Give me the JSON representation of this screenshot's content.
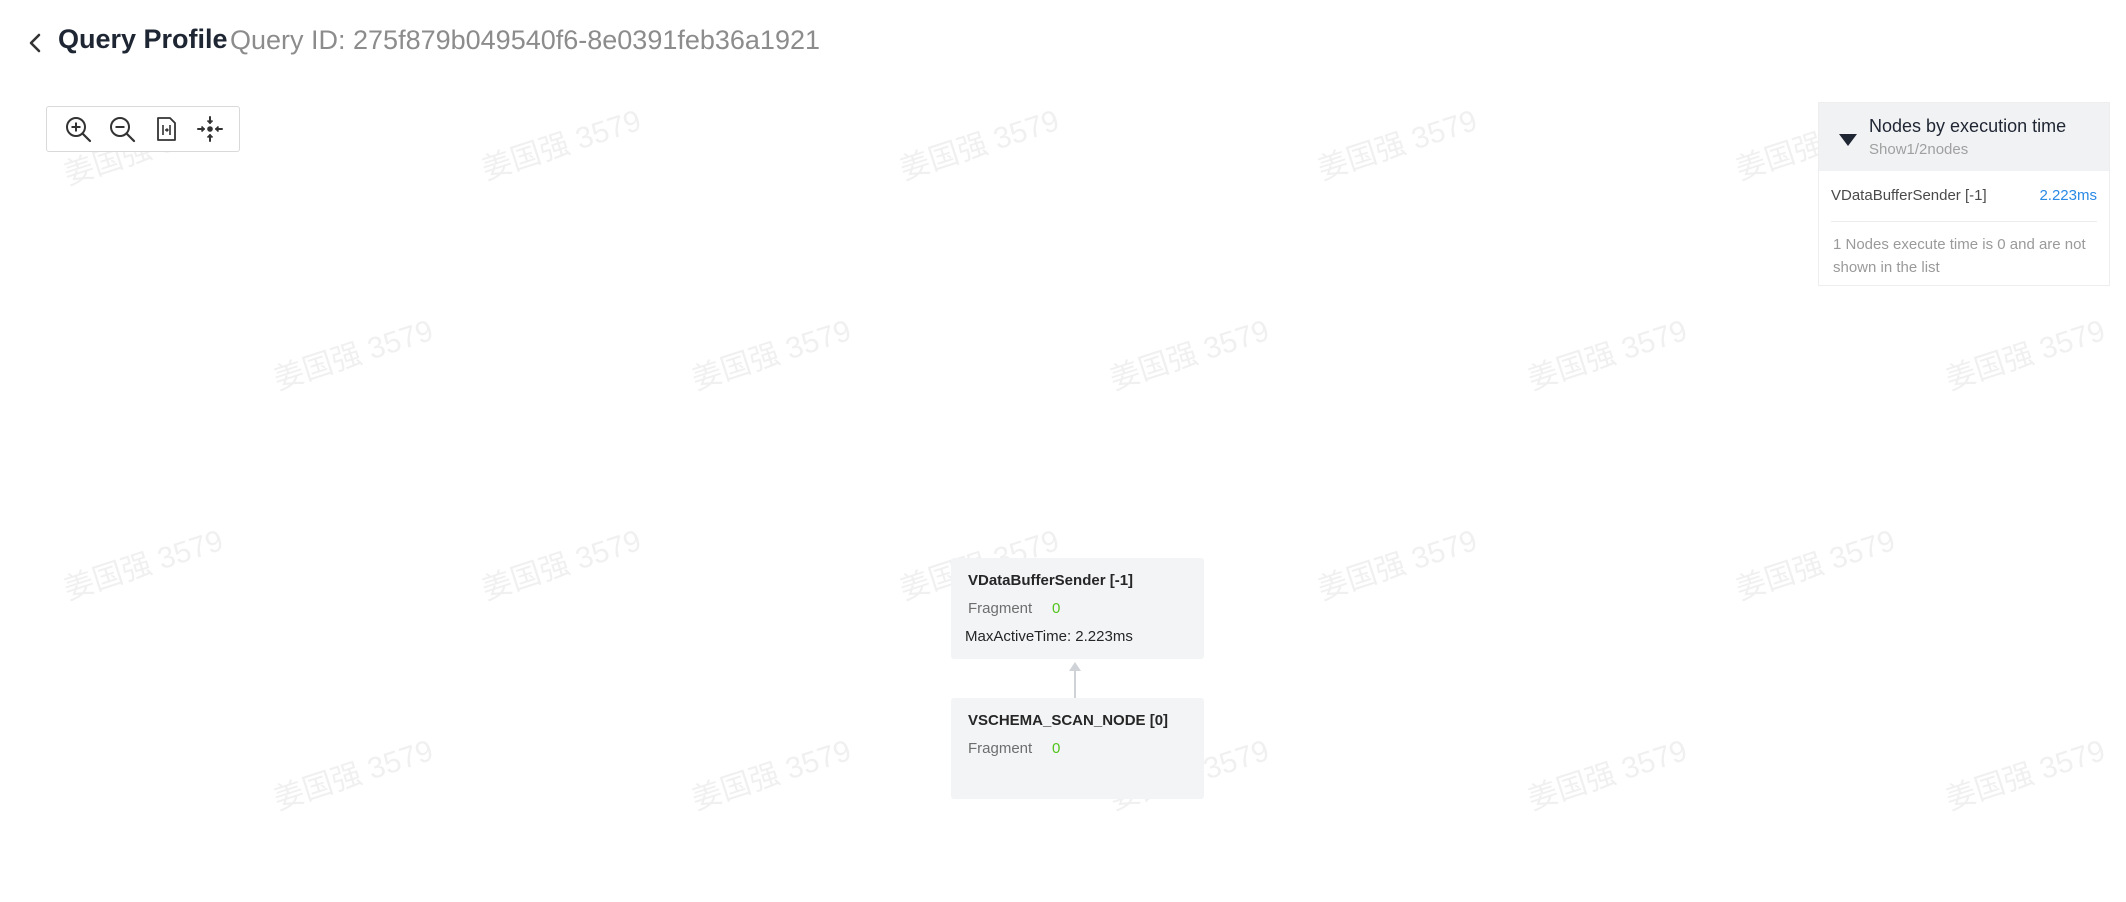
{
  "header": {
    "title": "Query Profile",
    "query_id": "Query ID: 275f879b049540f6-8e0391feb36a1921"
  },
  "toolbar": {
    "buttons": [
      {
        "icon": "zoom-in-icon"
      },
      {
        "icon": "zoom-out-icon"
      },
      {
        "icon": "fit-page-icon"
      },
      {
        "icon": "center-focus-icon"
      }
    ]
  },
  "panel": {
    "title": "Nodes by execution time",
    "subtitle": "Show1/2nodes",
    "rows": [
      {
        "name": "VDataBufferSender [-1]",
        "time": "2.223ms"
      }
    ],
    "note": "1 Nodes execute time is 0 and are not shown in the list"
  },
  "nodes": [
    {
      "title": "VDataBufferSender [-1]",
      "fragment_label": "Fragment",
      "fragment_value": "0",
      "metric": "MaxActiveTime: 2.223ms"
    },
    {
      "title": "VSCHEMA_SCAN_NODE [0]",
      "fragment_label": "Fragment",
      "fragment_value": "0"
    }
  ],
  "watermark": "姜国强 3579",
  "colors": {
    "accent": "#2a8ae6",
    "fragment_value": "#52c41a",
    "node_bg": "#f2f4f6",
    "panel_header_bg": "#f1f2f4"
  }
}
